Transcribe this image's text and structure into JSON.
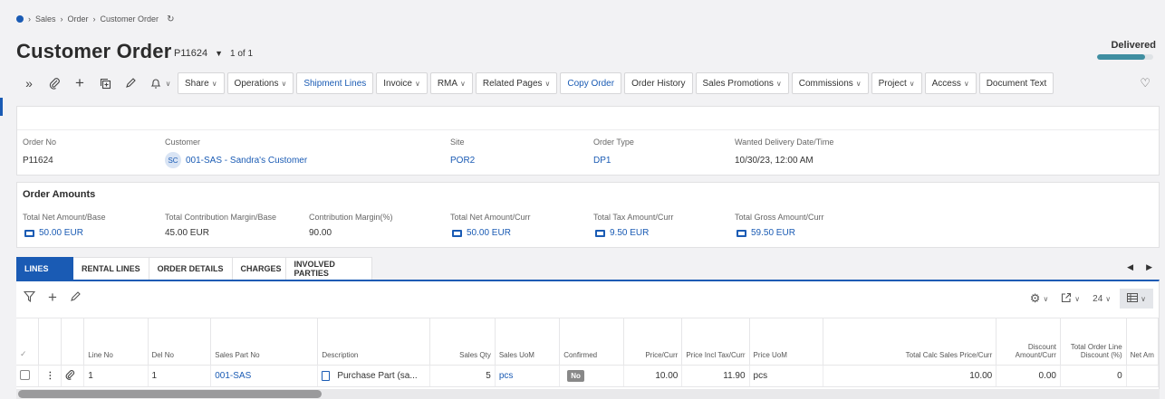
{
  "breadcrumb": {
    "items": [
      "Sales",
      "Order",
      "Customer Order"
    ]
  },
  "page": {
    "title": "Customer Order",
    "record": "P11624",
    "record_count": "1 of 1"
  },
  "status": {
    "label": "Delivered",
    "progress": 0.85,
    "color": "#3f8ea1"
  },
  "toolbar": {
    "buttons": [
      {
        "label": "Share",
        "menu": true,
        "blue": false
      },
      {
        "label": "Operations",
        "menu": true,
        "blue": false
      },
      {
        "label": "Shipment Lines",
        "menu": false,
        "blue": true
      },
      {
        "label": "Invoice",
        "menu": true,
        "blue": false
      },
      {
        "label": "RMA",
        "menu": true,
        "blue": false
      },
      {
        "label": "Related Pages",
        "menu": true,
        "blue": false
      },
      {
        "label": "Copy Order",
        "menu": false,
        "blue": true
      },
      {
        "label": "Order History",
        "menu": false,
        "blue": false
      },
      {
        "label": "Sales Promotions",
        "menu": true,
        "blue": false
      },
      {
        "label": "Commissions",
        "menu": true,
        "blue": false
      },
      {
        "label": "Project",
        "menu": true,
        "blue": false
      },
      {
        "label": "Access",
        "menu": true,
        "blue": false
      },
      {
        "label": "Document Text",
        "menu": false,
        "blue": false
      }
    ]
  },
  "header_fields": {
    "order_no": {
      "label": "Order No",
      "value": "P11624"
    },
    "customer": {
      "label": "Customer",
      "initials": "SC",
      "value": "001-SAS - Sandra's Customer"
    },
    "site": {
      "label": "Site",
      "value": "POR2"
    },
    "order_type": {
      "label": "Order Type",
      "value": "DP1"
    },
    "wanted_delivery": {
      "label": "Wanted Delivery Date/Time",
      "value": "10/30/23, 12:00 AM"
    }
  },
  "order_amounts": {
    "title": "Order Amounts",
    "total_net_base": {
      "label": "Total Net Amount/Base",
      "value": "50.00 EUR"
    },
    "total_contribution_margin": {
      "label": "Total Contribution Margin/Base",
      "value": "45.00 EUR"
    },
    "contribution_margin_pct": {
      "label": "Contribution Margin(%)",
      "value": "90.00"
    },
    "total_net_curr": {
      "label": "Total Net Amount/Curr",
      "value": "50.00 EUR"
    },
    "total_tax_curr": {
      "label": "Total Tax Amount/Curr",
      "value": "9.50 EUR"
    },
    "total_gross_curr": {
      "label": "Total Gross Amount/Curr",
      "value": "59.50 EUR"
    }
  },
  "tabs": [
    "LINES",
    "RENTAL LINES",
    "ORDER DETAILS",
    "CHARGES",
    "INVOLVED PARTIES"
  ],
  "grid_toolbar": {
    "page_size": "24"
  },
  "table": {
    "columns": {
      "line_no": "Line No",
      "del_no": "Del No",
      "sales_part_no": "Sales Part No",
      "description": "Description",
      "sales_qty": "Sales Qty",
      "sales_uom": "Sales UoM",
      "confirmed": "Confirmed",
      "price_curr": "Price/Curr",
      "price_incl_tax": "Price Incl Tax/Curr",
      "price_uom": "Price UoM",
      "total_calc_price": "Total Calc Sales Price/Curr",
      "discount_amount_1": "Discount",
      "discount_amount_2": "Amount/Curr",
      "total_order_line_1": "Total Order Line",
      "total_order_line_2": "Discount (%)",
      "net_amount": "Net Am"
    },
    "row": {
      "line_no": "1",
      "del_no": "1",
      "sales_part_no": "001-SAS",
      "description": "Purchase Part (sa...",
      "sales_qty": "5",
      "sales_uom": "pcs",
      "confirmed": "No",
      "price_curr": "10.00",
      "price_incl_tax": "11.90",
      "price_uom": "pcs",
      "total_calc_price": "10.00",
      "discount_amount": "0.00",
      "total_order_line_discount": "0"
    }
  }
}
